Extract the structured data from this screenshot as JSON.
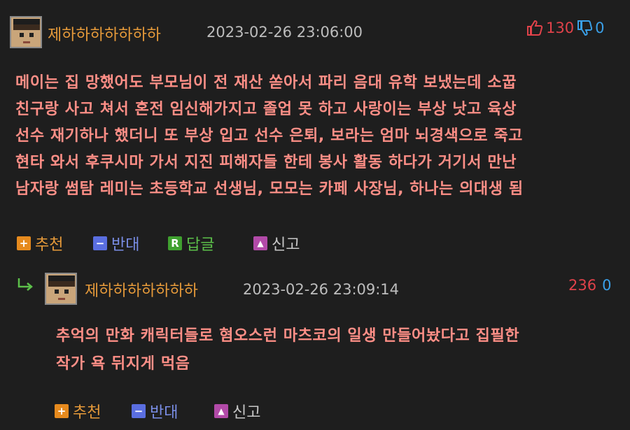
{
  "comment": {
    "nickname": "제하하하하하하하",
    "datetime": "2023-02-26 23:06:00",
    "upvotes": "130",
    "downvotes": "0",
    "lines": [
      "메이는 집 망했어도 부모님이 전 재산 쏟아서 파리 음대 유학 보냈는데 소꿉",
      "친구랑 사고 쳐서 혼전 임신해가지고 졸업 못 하고 사랑이는 부상 낫고 육상",
      "선수 재기하나 했더니 또 부상 입고 선수 은퇴, 보라는 엄마 뇌경색으로 죽고",
      "현타 와서 후쿠시마 가서 지진 피해자들 한테 봉사 활동 하다가 거기서 만난",
      "남자랑 썸탐 레미는 초등학교 선생님, 모모는 카페 사장님, 하나는 의대생 됨"
    ],
    "actions": {
      "recommend": "추천",
      "oppose": "반대",
      "reply": "답글",
      "report": "신고"
    }
  },
  "reply": {
    "nickname": "제하하하하하하하",
    "datetime": "2023-02-26 23:09:14",
    "upvotes": "236",
    "downvotes": "0",
    "lines": [
      "추억의 만화 캐릭터들로 혐오스런 마츠코의 일생 만들어놨다고 집필한",
      "작가 욕 뒤지게 먹음"
    ],
    "actions": {
      "recommend": "추천",
      "oppose": "반대",
      "report": "신고"
    }
  },
  "icons": {
    "upvote": "thumbs-up-icon",
    "downvote": "thumbs-down-icon",
    "reply_arrow": "reply-arrow-icon",
    "recommend": "plus-square-icon",
    "oppose": "minus-square-icon",
    "reply": "r-square-icon",
    "report": "siren-icon"
  },
  "colors": {
    "background": "#1e1e1e",
    "nickname": "#e69a3a",
    "body_text": "#ff8f87",
    "upvote": "#e0424a",
    "downvote": "#3aa0e8"
  }
}
